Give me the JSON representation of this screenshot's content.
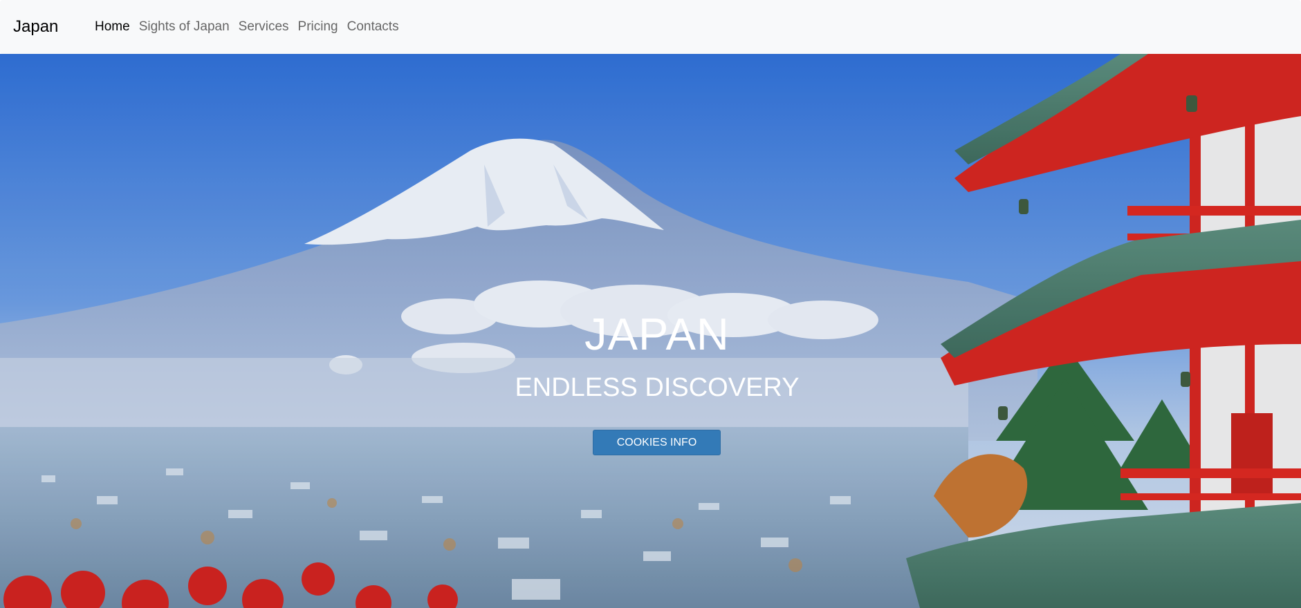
{
  "navbar": {
    "brand": "Japan",
    "links": [
      {
        "label": "Home",
        "active": true
      },
      {
        "label": "Sights of Japan",
        "active": false
      },
      {
        "label": "Services",
        "active": false
      },
      {
        "label": "Pricing",
        "active": false
      },
      {
        "label": "Contacts",
        "active": false
      }
    ]
  },
  "hero": {
    "title": "JAPAN",
    "subtitle": "ENDLESS DISCOVERY",
    "button_label": "COOKIES INFO",
    "background": "mount-fuji-pagoda-photo"
  },
  "colors": {
    "navbar_bg": "#f8f9fa",
    "button_bg": "#337ab7",
    "sky": "#3a7bd5",
    "pagoda_red": "#e0261b"
  }
}
